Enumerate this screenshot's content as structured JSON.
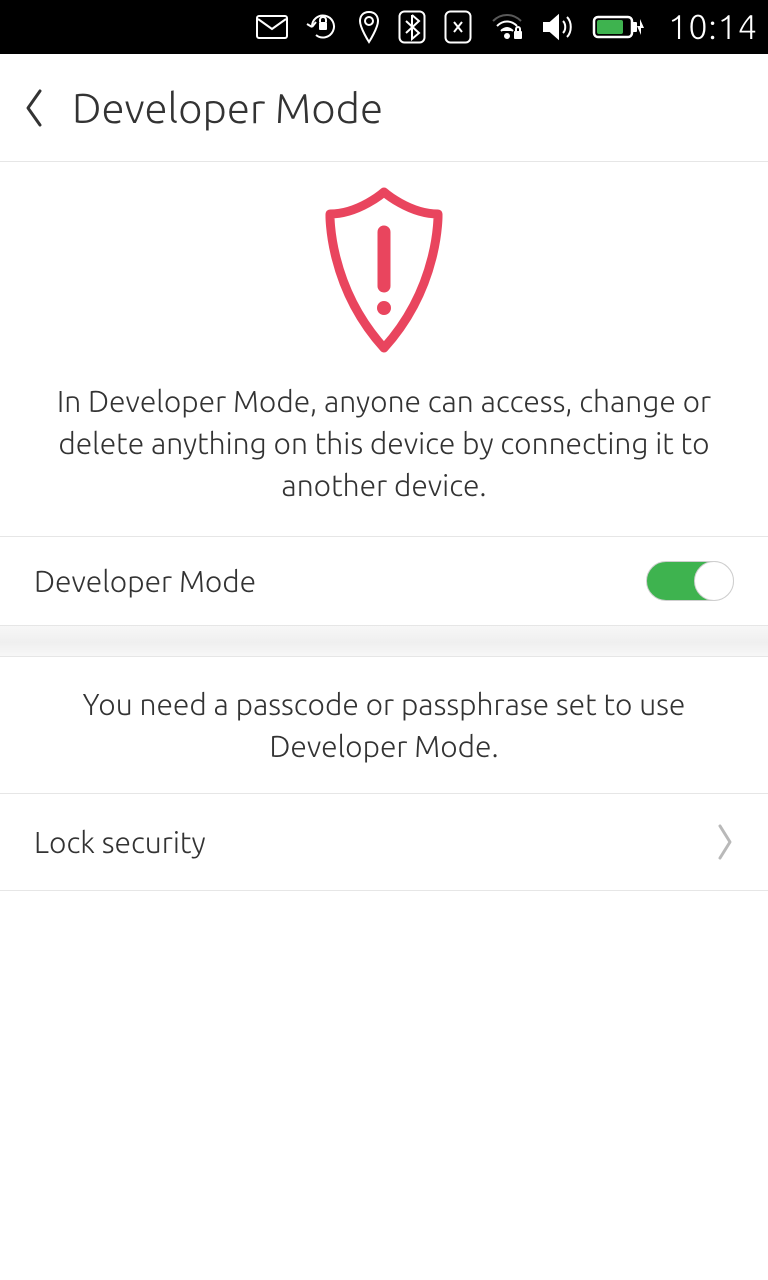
{
  "status_bar": {
    "time": "10:14"
  },
  "header": {
    "title": "Developer Mode"
  },
  "warning": {
    "text": "In Developer Mode, anyone can access, change or delete anything on this device by connecting it to another device."
  },
  "toggle": {
    "label": "Developer Mode",
    "on": true
  },
  "info": {
    "text": "You need a passcode or passphrase set to use Developer Mode."
  },
  "link": {
    "label": "Lock security"
  }
}
